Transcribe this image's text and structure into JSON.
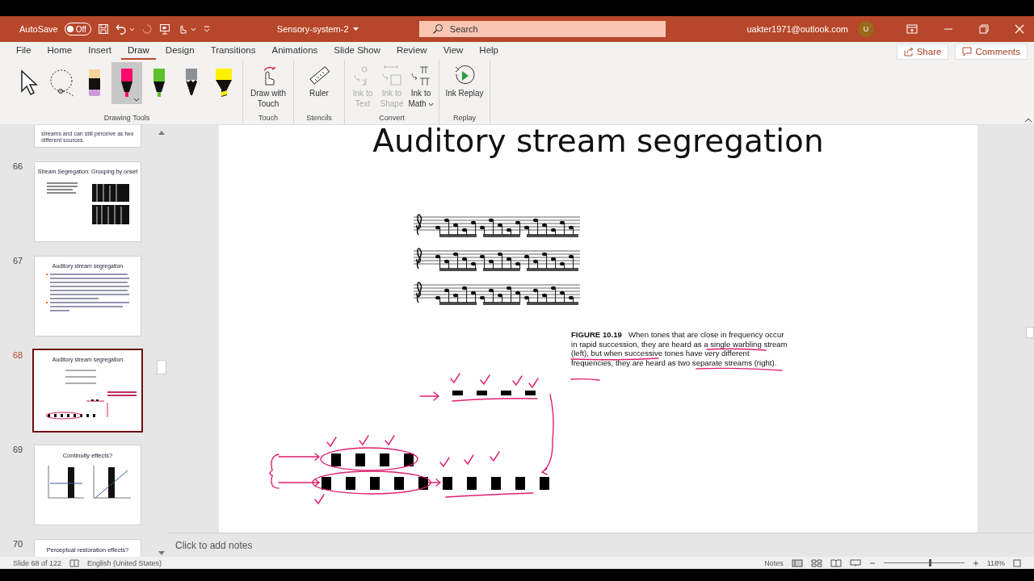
{
  "title_bar": {
    "autosave_label": "AutoSave",
    "autosave_on": false,
    "autosave_state": "Off",
    "document_title": "Sensory-system-2",
    "search_placeholder": "Search",
    "account": "uakter1971@outlook.com",
    "avatar_initial": "U"
  },
  "ribbon_tabs": [
    {
      "label": "File",
      "selected": false
    },
    {
      "label": "Home",
      "selected": false
    },
    {
      "label": "Insert",
      "selected": false
    },
    {
      "label": "Draw",
      "selected": true
    },
    {
      "label": "Design",
      "selected": false
    },
    {
      "label": "Transitions",
      "selected": false
    },
    {
      "label": "Animations",
      "selected": false
    },
    {
      "label": "Slide Show",
      "selected": false
    },
    {
      "label": "Review",
      "selected": false
    },
    {
      "label": "View",
      "selected": false
    },
    {
      "label": "Help",
      "selected": false
    }
  ],
  "share": "Share",
  "comments": "Comments",
  "drawing_tools": {
    "label": "Drawing Tools",
    "tools": [
      {
        "kind": "select",
        "selected": false
      },
      {
        "kind": "lasso",
        "selected": false
      },
      {
        "kind": "eraser",
        "selected": false
      },
      {
        "kind": "pen",
        "color": "#ff0a6c",
        "selected": true
      },
      {
        "kind": "pen",
        "color": "#5cc12a",
        "selected": false
      },
      {
        "kind": "pencil",
        "color": "#8a9199",
        "selected": false
      },
      {
        "kind": "highlighter",
        "color": "#fff200",
        "selected": false
      }
    ]
  },
  "ribbon_groups": [
    {
      "label": "Touch",
      "buttons": [
        {
          "kind": "touch",
          "label": "Draw with Touch",
          "disabled": false,
          "dropdown": false
        }
      ]
    },
    {
      "label": "Stencils",
      "buttons": [
        {
          "kind": "ruler",
          "label": "Ruler",
          "disabled": false,
          "dropdown": false
        }
      ]
    },
    {
      "label": "Convert",
      "buttons": [
        {
          "kind": "ink-text",
          "label": "Ink to Text",
          "disabled": true,
          "dropdown": false
        },
        {
          "kind": "ink-shape",
          "label": "Ink to Shape",
          "disabled": true,
          "dropdown": false
        },
        {
          "kind": "ink-math",
          "label": "Ink to Math",
          "disabled": false,
          "dropdown": true
        }
      ]
    },
    {
      "label": "Replay",
      "buttons": [
        {
          "kind": "replay",
          "label": "Ink Replay",
          "disabled": false,
          "dropdown": false
        }
      ]
    }
  ],
  "slides": [
    {
      "kind": "partial",
      "text": "streams and can still perceive as two different sources.",
      "selected": false
    },
    {
      "number": "66",
      "kind": "spectrogram",
      "title": "Stream Segregation: Grouping by onset",
      "selected": false
    },
    {
      "number": "67",
      "kind": "bullets",
      "title": "Auditory stream segregation",
      "selected": false
    },
    {
      "number": "68",
      "kind": "ink",
      "title": "Auditory stream segregation",
      "selected": true
    },
    {
      "number": "69",
      "kind": "chart",
      "title": "Continuity effects?",
      "selected": false
    },
    {
      "number": "70",
      "kind": "title-only",
      "title": "Perceptual restoration effects?",
      "selected": false
    }
  ],
  "slide": {
    "title": "Auditory stream segregation",
    "caption_label": "FIGURE 10.19",
    "caption": "When tones that are close in frequency occur in rapid succession, they are heard as a single warbling stream (left), but when successive tones have very different frequencies, they are heard as two separate streams (right)."
  },
  "notes_placeholder": "Click to add notes",
  "status_bar": {
    "slide_count": "Slide 68 of 122",
    "language": "English (United States)",
    "notes": "Notes",
    "zoom": "118%",
    "zoom_slider": {
      "level": 0.56
    }
  }
}
